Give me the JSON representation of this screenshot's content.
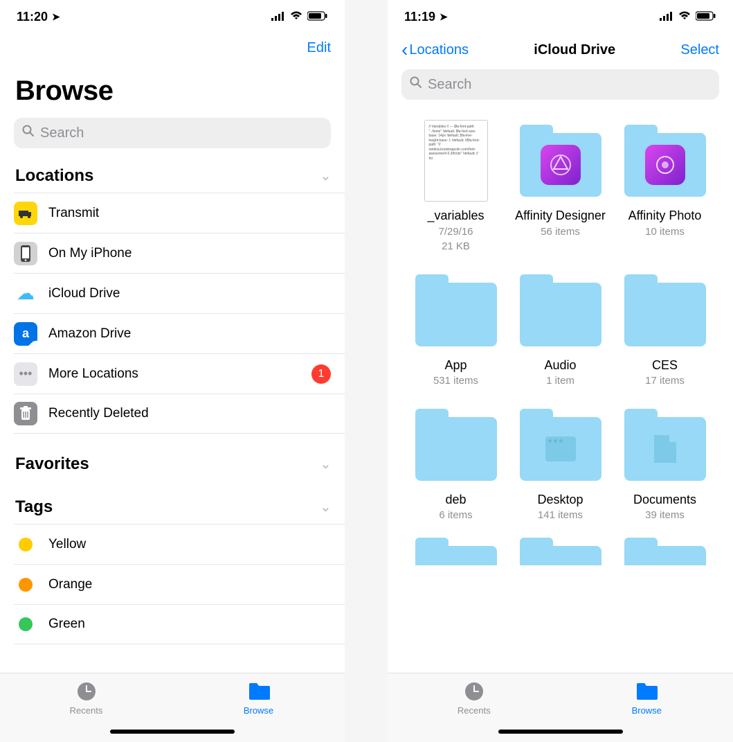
{
  "left": {
    "status": {
      "time": "11:20"
    },
    "nav": {
      "edit": "Edit"
    },
    "title": "Browse",
    "search_placeholder": "Search",
    "sections": {
      "locations": "Locations",
      "favorites": "Favorites",
      "tags": "Tags"
    },
    "locations": [
      {
        "label": "Transmit",
        "icon": "transmit"
      },
      {
        "label": "On My iPhone",
        "icon": "iphone"
      },
      {
        "label": "iCloud Drive",
        "icon": "icloud"
      },
      {
        "label": "Amazon Drive",
        "icon": "amazon"
      },
      {
        "label": "More Locations",
        "icon": "more",
        "badge": "1"
      },
      {
        "label": "Recently Deleted",
        "icon": "trash"
      }
    ],
    "tags": [
      {
        "label": "Yellow",
        "color": "#ffcc00"
      },
      {
        "label": "Orange",
        "color": "#ff9500"
      },
      {
        "label": "Green",
        "color": "#34c759"
      }
    ],
    "tabs": {
      "recents": "Recents",
      "browse": "Browse"
    }
  },
  "right": {
    "status": {
      "time": "11:19"
    },
    "nav": {
      "back": "Locations",
      "title": "iCloud Drive",
      "select": "Select"
    },
    "search_placeholder": "Search",
    "items": [
      {
        "name": "_variables",
        "meta1": "7/29/16",
        "meta2": "21 KB",
        "type": "file"
      },
      {
        "name": "Affinity Designer",
        "meta1": "56 items",
        "type": "folder-app"
      },
      {
        "name": "Affinity Photo",
        "meta1": "10 items",
        "type": "folder-app"
      },
      {
        "name": "App",
        "meta1": "531 items",
        "type": "folder"
      },
      {
        "name": "Audio",
        "meta1": "1 item",
        "type": "folder"
      },
      {
        "name": "CES",
        "meta1": "17 items",
        "type": "folder"
      },
      {
        "name": "deb",
        "meta1": "6 items",
        "type": "folder"
      },
      {
        "name": "Desktop",
        "meta1": "141 items",
        "type": "folder-window"
      },
      {
        "name": "Documents",
        "meta1": "39 items",
        "type": "folder-doc"
      }
    ],
    "tabs": {
      "recents": "Recents",
      "browse": "Browse"
    }
  },
  "file_preview_text": "// Variables\n//\n---\n$fa-font-path:\n\"../fonts\" !default;\n$fa-font-size-base:\n14px !default;\n$fa-line-height-base:\n1 !default;\n//$fa-font-path:\n\"//\nnetdna.bootstrapcdn.com/font-awesome/4.6.3/fonts\" !default; // for"
}
